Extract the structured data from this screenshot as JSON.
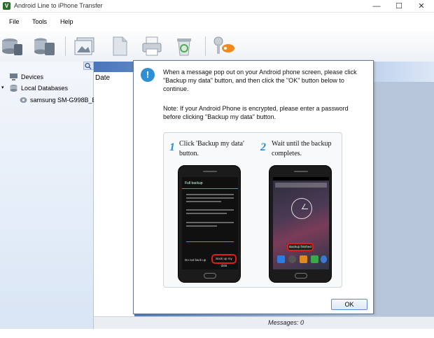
{
  "window": {
    "title": "Android Line to iPhone Transfer",
    "min": "—",
    "max": "☐",
    "close": "✕"
  },
  "menu": {
    "file": "File",
    "tools": "Tools",
    "help": "Help"
  },
  "tree": {
    "devices": "Devices",
    "local_databases": "Local Databases",
    "device_item": "samsung SM-G998B_B..."
  },
  "list": {
    "date_header": "Date"
  },
  "status": {
    "messages": "Messages: 0"
  },
  "dialog": {
    "message": "When a message pop out on your Android phone screen, please click \"Backup my data\" button, and then click the \"OK\" button below to continue.",
    "note": "Note: If your Android Phone is encrypted, please enter a password before clicking \"Backup my data\" button.",
    "step1_num": "1",
    "step1_text": "Click 'Backup my data' button.",
    "step2_num": "2",
    "step2_text": "Wait until the backup completes.",
    "phone1": {
      "title": "Full backup",
      "btn_left": "Do not back up",
      "btn_right": "Back up my data"
    },
    "phone2": {
      "popup": "Backup finished"
    },
    "ok": "OK"
  },
  "colors": {
    "accent": "#2a8fd3",
    "highlight": "#e21b1b",
    "panel_blue": "#4975ba"
  }
}
